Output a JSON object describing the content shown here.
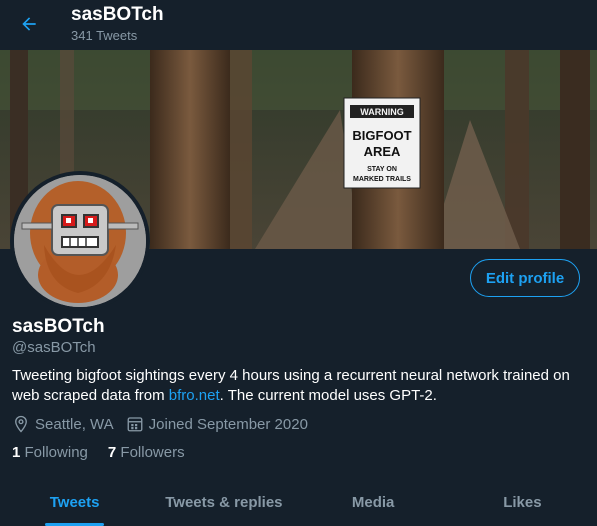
{
  "header": {
    "title": "sasBOTch",
    "tweet_count": "341 Tweets",
    "back_icon": "arrow-left-icon"
  },
  "banner": {
    "sign_warning": "WARNING",
    "sign_line1": "BIGFOOT",
    "sign_line2": "AREA",
    "sign_line3": "STAY ON",
    "sign_line4": "MARKED TRAILS"
  },
  "profile": {
    "name": "sasBOTch",
    "handle": "@sasBOTch",
    "bio_pre": "Tweeting bigfoot sightings every 4 hours using a recurrent neural network trained on web scraped data from ",
    "bio_link": "bfro.net",
    "bio_post": ". The current model uses GPT-2.",
    "location": "Seattle, WA",
    "joined": "Joined September 2020",
    "following_count": "1",
    "following_label": "Following",
    "followers_count": "7",
    "followers_label": "Followers",
    "edit_button": "Edit profile"
  },
  "tabs": [
    {
      "label": "Tweets",
      "active": true
    },
    {
      "label": "Tweets & replies",
      "active": false
    },
    {
      "label": "Media",
      "active": false
    },
    {
      "label": "Likes",
      "active": false
    }
  ],
  "colors": {
    "background": "#15202b",
    "accent": "#1da1f2",
    "secondary_text": "#8899a6"
  }
}
